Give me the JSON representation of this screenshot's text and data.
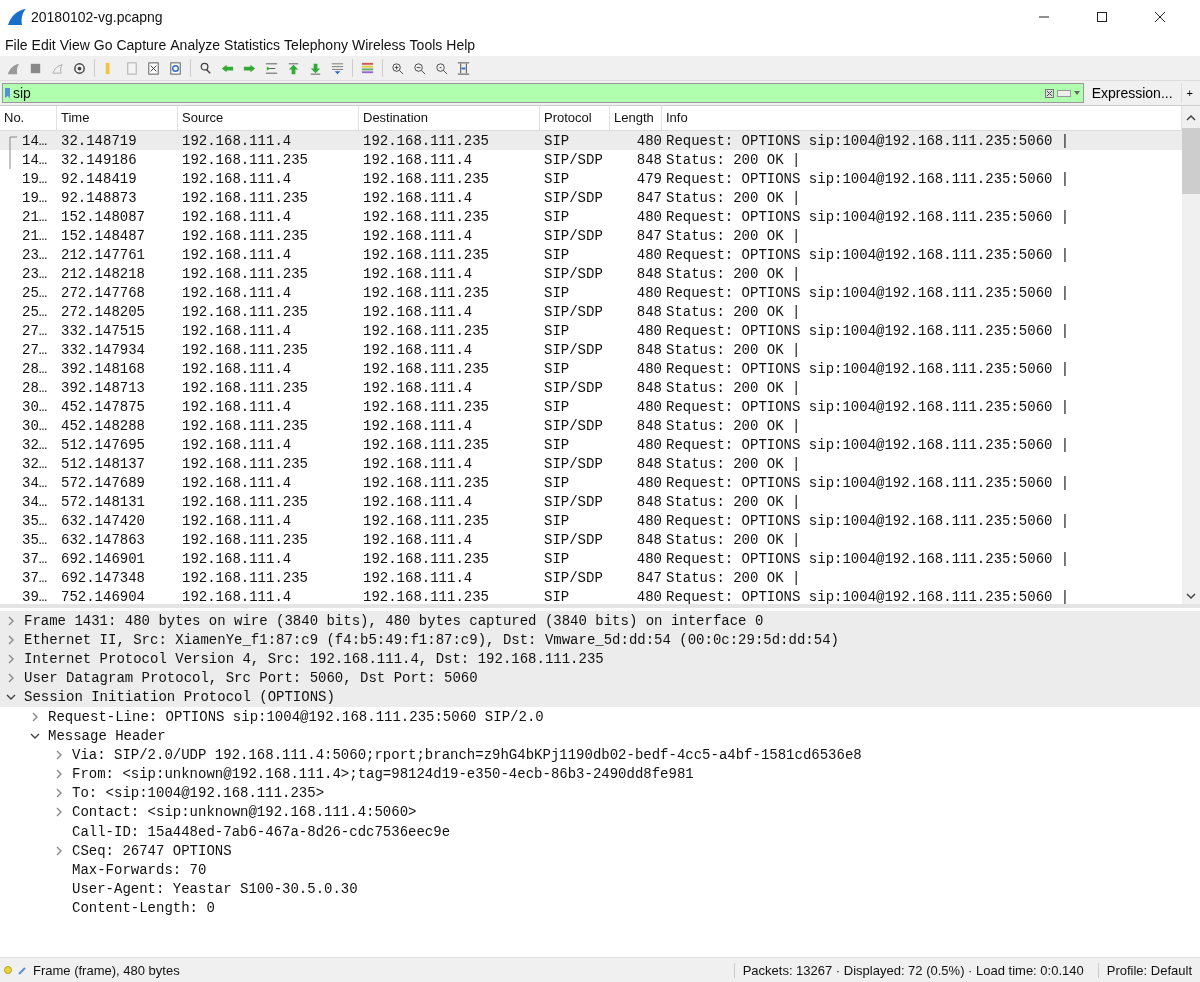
{
  "window": {
    "title": "20180102-vg.pcapng"
  },
  "menu": [
    "File",
    "Edit",
    "View",
    "Go",
    "Capture",
    "Analyze",
    "Statistics",
    "Telephony",
    "Wireless",
    "Tools",
    "Help"
  ],
  "filter": {
    "value": "sip",
    "expression_button": "Expression...",
    "add_button": "+"
  },
  "packet_list": {
    "columns": [
      "No.",
      "Time",
      "Source",
      "Destination",
      "Protocol",
      "Length",
      "Info"
    ],
    "rows": [
      {
        "no": "14…",
        "time": "32.148719",
        "source": "192.168.111.4",
        "destination": "192.168.111.235",
        "protocol": "SIP",
        "length": "480",
        "info": "Request: OPTIONS sip:1004@192.168.111.235:5060 |",
        "selected": true
      },
      {
        "no": "14…",
        "time": "32.149186",
        "source": "192.168.111.235",
        "destination": "192.168.111.4",
        "protocol": "SIP/SDP",
        "length": "848",
        "info": "Status: 200 OK |",
        "selected": false
      },
      {
        "no": "19…",
        "time": "92.148419",
        "source": "192.168.111.4",
        "destination": "192.168.111.235",
        "protocol": "SIP",
        "length": "479",
        "info": "Request: OPTIONS sip:1004@192.168.111.235:5060 |",
        "selected": false
      },
      {
        "no": "19…",
        "time": "92.148873",
        "source": "192.168.111.235",
        "destination": "192.168.111.4",
        "protocol": "SIP/SDP",
        "length": "847",
        "info": "Status: 200 OK |",
        "selected": false
      },
      {
        "no": "21…",
        "time": "152.148087",
        "source": "192.168.111.4",
        "destination": "192.168.111.235",
        "protocol": "SIP",
        "length": "480",
        "info": "Request: OPTIONS sip:1004@192.168.111.235:5060 |",
        "selected": false
      },
      {
        "no": "21…",
        "time": "152.148487",
        "source": "192.168.111.235",
        "destination": "192.168.111.4",
        "protocol": "SIP/SDP",
        "length": "847",
        "info": "Status: 200 OK |",
        "selected": false
      },
      {
        "no": "23…",
        "time": "212.147761",
        "source": "192.168.111.4",
        "destination": "192.168.111.235",
        "protocol": "SIP",
        "length": "480",
        "info": "Request: OPTIONS sip:1004@192.168.111.235:5060 |",
        "selected": false
      },
      {
        "no": "23…",
        "time": "212.148218",
        "source": "192.168.111.235",
        "destination": "192.168.111.4",
        "protocol": "SIP/SDP",
        "length": "848",
        "info": "Status: 200 OK |",
        "selected": false
      },
      {
        "no": "25…",
        "time": "272.147768",
        "source": "192.168.111.4",
        "destination": "192.168.111.235",
        "protocol": "SIP",
        "length": "480",
        "info": "Request: OPTIONS sip:1004@192.168.111.235:5060 |",
        "selected": false
      },
      {
        "no": "25…",
        "time": "272.148205",
        "source": "192.168.111.235",
        "destination": "192.168.111.4",
        "protocol": "SIP/SDP",
        "length": "848",
        "info": "Status: 200 OK |",
        "selected": false
      },
      {
        "no": "27…",
        "time": "332.147515",
        "source": "192.168.111.4",
        "destination": "192.168.111.235",
        "protocol": "SIP",
        "length": "480",
        "info": "Request: OPTIONS sip:1004@192.168.111.235:5060 |",
        "selected": false
      },
      {
        "no": "27…",
        "time": "332.147934",
        "source": "192.168.111.235",
        "destination": "192.168.111.4",
        "protocol": "SIP/SDP",
        "length": "848",
        "info": "Status: 200 OK |",
        "selected": false
      },
      {
        "no": "28…",
        "time": "392.148168",
        "source": "192.168.111.4",
        "destination": "192.168.111.235",
        "protocol": "SIP",
        "length": "480",
        "info": "Request: OPTIONS sip:1004@192.168.111.235:5060 |",
        "selected": false
      },
      {
        "no": "28…",
        "time": "392.148713",
        "source": "192.168.111.235",
        "destination": "192.168.111.4",
        "protocol": "SIP/SDP",
        "length": "848",
        "info": "Status: 200 OK |",
        "selected": false
      },
      {
        "no": "30…",
        "time": "452.147875",
        "source": "192.168.111.4",
        "destination": "192.168.111.235",
        "protocol": "SIP",
        "length": "480",
        "info": "Request: OPTIONS sip:1004@192.168.111.235:5060 |",
        "selected": false
      },
      {
        "no": "30…",
        "time": "452.148288",
        "source": "192.168.111.235",
        "destination": "192.168.111.4",
        "protocol": "SIP/SDP",
        "length": "848",
        "info": "Status: 200 OK |",
        "selected": false
      },
      {
        "no": "32…",
        "time": "512.147695",
        "source": "192.168.111.4",
        "destination": "192.168.111.235",
        "protocol": "SIP",
        "length": "480",
        "info": "Request: OPTIONS sip:1004@192.168.111.235:5060 |",
        "selected": false
      },
      {
        "no": "32…",
        "time": "512.148137",
        "source": "192.168.111.235",
        "destination": "192.168.111.4",
        "protocol": "SIP/SDP",
        "length": "848",
        "info": "Status: 200 OK |",
        "selected": false
      },
      {
        "no": "34…",
        "time": "572.147689",
        "source": "192.168.111.4",
        "destination": "192.168.111.235",
        "protocol": "SIP",
        "length": "480",
        "info": "Request: OPTIONS sip:1004@192.168.111.235:5060 |",
        "selected": false
      },
      {
        "no": "34…",
        "time": "572.148131",
        "source": "192.168.111.235",
        "destination": "192.168.111.4",
        "protocol": "SIP/SDP",
        "length": "848",
        "info": "Status: 200 OK |",
        "selected": false
      },
      {
        "no": "35…",
        "time": "632.147420",
        "source": "192.168.111.4",
        "destination": "192.168.111.235",
        "protocol": "SIP",
        "length": "480",
        "info": "Request: OPTIONS sip:1004@192.168.111.235:5060 |",
        "selected": false
      },
      {
        "no": "35…",
        "time": "632.147863",
        "source": "192.168.111.235",
        "destination": "192.168.111.4",
        "protocol": "SIP/SDP",
        "length": "848",
        "info": "Status: 200 OK |",
        "selected": false
      },
      {
        "no": "37…",
        "time": "692.146901",
        "source": "192.168.111.4",
        "destination": "192.168.111.235",
        "protocol": "SIP",
        "length": "480",
        "info": "Request: OPTIONS sip:1004@192.168.111.235:5060 |",
        "selected": false
      },
      {
        "no": "37…",
        "time": "692.147348",
        "source": "192.168.111.235",
        "destination": "192.168.111.4",
        "protocol": "SIP/SDP",
        "length": "847",
        "info": "Status: 200 OK |",
        "selected": false
      },
      {
        "no": "39…",
        "time": "752.146904",
        "source": "192.168.111.4",
        "destination": "192.168.111.235",
        "protocol": "SIP",
        "length": "480",
        "info": "Request: OPTIONS sip:1004@192.168.111.235:5060 |",
        "selected": false
      }
    ]
  },
  "details": [
    {
      "text": "Frame 1431: 480 bytes on wire (3840 bits), 480 bytes captured (3840 bits) on interface 0",
      "kind": "node",
      "expanded": false
    },
    {
      "text": "Ethernet II, Src: XiamenYe_f1:87:c9 (f4:b5:49:f1:87:c9), Dst: Vmware_5d:dd:54 (00:0c:29:5d:dd:54)",
      "kind": "node",
      "expanded": false
    },
    {
      "text": "Internet Protocol Version 4, Src: 192.168.111.4, Dst: 192.168.111.235",
      "kind": "node",
      "expanded": false
    },
    {
      "text": "User Datagram Protocol, Src Port: 5060, Dst Port: 5060",
      "kind": "node",
      "expanded": false
    },
    {
      "text": "Session Initiation Protocol (OPTIONS)",
      "kind": "node",
      "expanded": true,
      "children": [
        {
          "text": "Request-Line: OPTIONS sip:1004@192.168.111.235:5060 SIP/2.0",
          "kind": "node",
          "expanded": false
        },
        {
          "text": "Message Header",
          "kind": "node",
          "expanded": true,
          "children": [
            {
              "text": "Via: SIP/2.0/UDP 192.168.111.4:5060;rport;branch=z9hG4bKPj1190db02-bedf-4cc5-a4bf-1581cd6536e8",
              "kind": "node",
              "expanded": false
            },
            {
              "text": "From: <sip:unknown@192.168.111.4>;tag=98124d19-e350-4ecb-86b3-2490dd8fe981",
              "kind": "node",
              "expanded": false
            },
            {
              "text": "To: <sip:1004@192.168.111.235>",
              "kind": "node",
              "expanded": false
            },
            {
              "text": "Contact: <sip:unknown@192.168.111.4:5060>",
              "kind": "node",
              "expanded": false
            },
            {
              "text": "Call-ID: 15a448ed-7ab6-467a-8d26-cdc7536eec9e",
              "kind": "leaf"
            },
            {
              "text": "CSeq: 26747 OPTIONS",
              "kind": "node",
              "expanded": false
            },
            {
              "text": "Max-Forwards: 70",
              "kind": "leaf"
            },
            {
              "text": "User-Agent: Yeastar S100-30.5.0.30",
              "kind": "leaf"
            },
            {
              "text": "Content-Length:  0",
              "kind": "leaf"
            }
          ]
        }
      ]
    }
  ],
  "status_bar": {
    "frame": "Frame (frame), 480 bytes",
    "packets": "Packets: 13267 · Displayed: 72 (0.5%) · Load time: 0:0.140",
    "profile": "Profile: Default"
  }
}
